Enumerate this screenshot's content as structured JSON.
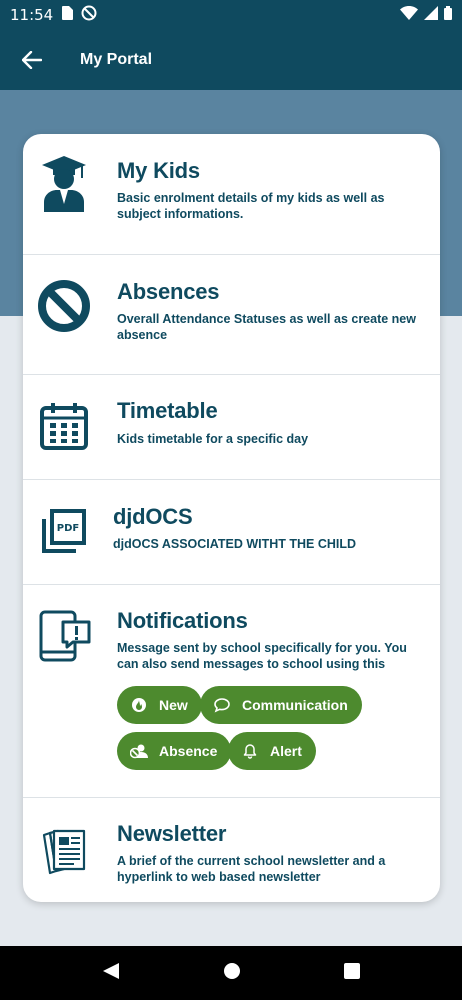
{
  "status": {
    "time": "11:54"
  },
  "app_bar": {
    "title": "My Portal"
  },
  "colors": {
    "primary": "#0f4a5f",
    "hero": "#5a84a0",
    "chip": "#4d8a2e",
    "background": "#e4e9ee"
  },
  "items": [
    {
      "title": "My Kids",
      "desc": "Basic enrolment details of my kids as well as subject informations.",
      "icon": "graduate-icon"
    },
    {
      "title": "Absences",
      "desc": "Overall Attendance Statuses as well as create new absence",
      "icon": "prohibited-icon"
    },
    {
      "title": "Timetable",
      "desc": "Kids timetable for a specific day",
      "icon": "calendar-icon"
    },
    {
      "title": "djdOCS",
      "desc": "djdOCS ASSOCIATED WITHT THE CHILD",
      "icon": "pdf-icon"
    },
    {
      "title": "Notifications",
      "desc": "Message sent by school specifically for you. You can also send messages to school using this",
      "icon": "tablet-alert-icon"
    },
    {
      "title": "Newsletter",
      "desc": "A brief of the current school newsletter and a hyperlink to web based newsletter",
      "icon": "newspaper-icon"
    }
  ],
  "notification_chips": [
    {
      "label": "New",
      "icon": "fire-icon"
    },
    {
      "label": "Communication",
      "icon": "chat-bubble-icon"
    },
    {
      "label": "Absence",
      "icon": "person-absent-icon"
    },
    {
      "label": "Alert",
      "icon": "bell-icon"
    }
  ]
}
